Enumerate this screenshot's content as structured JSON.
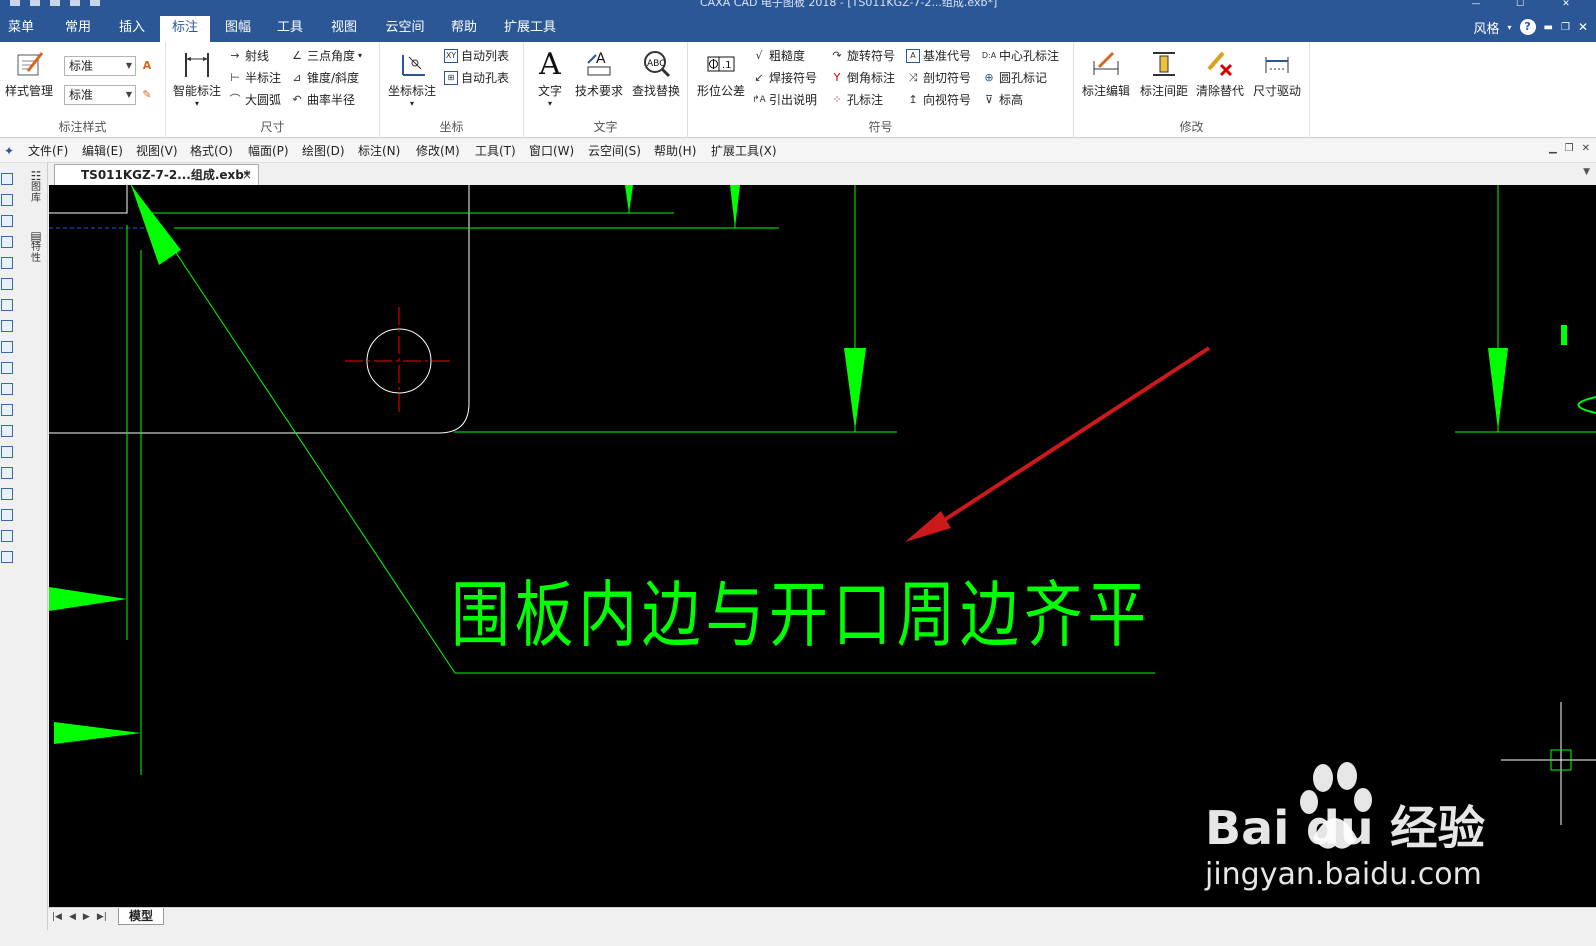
{
  "window": {
    "title": "CAXA CAD 电子图板 2018 - [TS011KGZ-7-2...组成.exb*]",
    "style_label": "风格",
    "help": "?"
  },
  "ribbon_tabs": [
    "菜单",
    "常用",
    "插入",
    "标注",
    "图幅",
    "工具",
    "视图",
    "云空间",
    "帮助",
    "扩展工具"
  ],
  "active_tab": "标注",
  "groups": {
    "style": {
      "label": "标注样式",
      "manage": "样式管理",
      "combo1": "标准",
      "combo2": "标准"
    },
    "dimension": {
      "label": "尺寸",
      "smart": "智能标注",
      "ray": "射线",
      "half": "半标注",
      "arc": "大圆弧",
      "angle3": "三点角度",
      "taper": "锥度/斜度",
      "curvature": "曲率半径"
    },
    "coord": {
      "label": "坐标",
      "coord_dim": "坐标标注",
      "auto_list": "自动列表",
      "auto_hole": "自动孔表"
    },
    "text": {
      "label": "文字",
      "text": "文字",
      "tech": "技术要求",
      "find": "查找替换"
    },
    "symbol": {
      "label": "符号",
      "geom_tol": "形位公差",
      "roughness": "粗糙度",
      "weld": "焊接符号",
      "leader": "引出说明",
      "rotate": "旋转符号",
      "chamfer": "倒角标注",
      "hole": "孔标注",
      "datum": "基准代号",
      "section": "剖切符号",
      "view_sym": "向视符号",
      "center_hole": "中心孔标注",
      "circle_hole": "圆孔标记",
      "elevation": "标高"
    },
    "modify": {
      "label": "修改",
      "edit": "标注编辑",
      "spacing": "标注间距",
      "clear": "清除替代",
      "drive": "尺寸驱动"
    }
  },
  "menubar": [
    "文件(F)",
    "编辑(E)",
    "视图(V)",
    "格式(O)",
    "幅面(P)",
    "绘图(D)",
    "标注(N)",
    "修改(M)",
    "工具(T)",
    "窗口(W)",
    "云空间(S)",
    "帮助(H)",
    "扩展工具(X)"
  ],
  "doc_tab": {
    "name": "TS011KGZ-7-2...组成.exb*",
    "close": "×"
  },
  "side_tabs": [
    "图库",
    "特性"
  ],
  "canvas": {
    "annotation": "围板内边与开口周边齐平"
  },
  "bottom": {
    "model_tab": "模型"
  },
  "watermark": {
    "brand": "Bai du 经验",
    "url": "jingyan.baidu.com"
  },
  "colors": {
    "ribbon_blue": "#2b5797",
    "canvas_bg": "#000000",
    "cad_green": "#00ff00",
    "cad_red": "#ff0000",
    "arrow_red": "#cc1a1a"
  }
}
